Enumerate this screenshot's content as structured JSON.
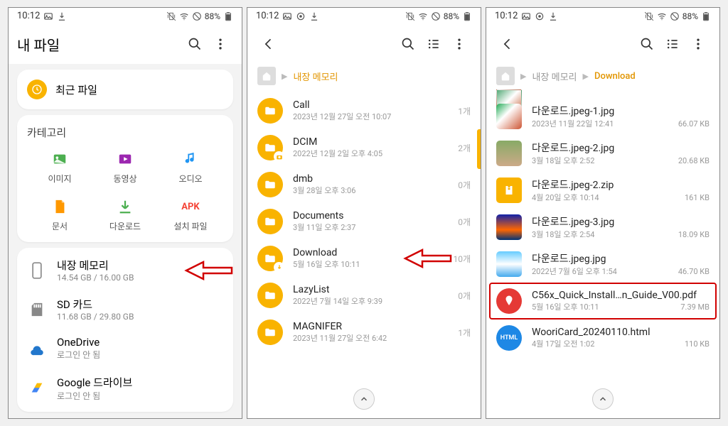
{
  "status": {
    "time": "10:12",
    "battery": "88%"
  },
  "s1": {
    "title": "내 파일",
    "recent": "최근 파일",
    "cat_title": "카테고리",
    "cats": [
      {
        "label": "이미지",
        "color": "#4CAF50"
      },
      {
        "label": "동영상",
        "color": "#9C27B0"
      },
      {
        "label": "오디오",
        "color": "#2196F3"
      },
      {
        "label": "문서",
        "color": "#FF9800"
      },
      {
        "label": "다운로드",
        "color": "#4CAF50"
      },
      {
        "label": "설치 파일",
        "color": "#FF5722",
        "text": "APK"
      }
    ],
    "storage": [
      {
        "name": "내장 메모리",
        "sub": "14.54 GB / 16.00 GB",
        "arrow": true
      },
      {
        "name": "SD 카드",
        "sub": "11.68 GB / 29.80 GB"
      },
      {
        "name": "OneDrive",
        "sub": "로그인 안 됨"
      },
      {
        "name": "Google 드라이브",
        "sub": "로그인 안 됨"
      }
    ]
  },
  "s2": {
    "crumb": "내장 메모리",
    "folders": [
      {
        "name": "Call",
        "sub": "2023년 12월 27일 오전 10:07",
        "count": "1개"
      },
      {
        "name": "DCIM",
        "sub": "2022년 12월 2일 오후 4:05",
        "count": "2개",
        "badge": "cam",
        "scroll": true
      },
      {
        "name": "dmb",
        "sub": "3월 28일 오후 3:06",
        "count": "0개"
      },
      {
        "name": "Documents",
        "sub": "3월 11일 오후 2:37",
        "count": "0개"
      },
      {
        "name": "Download",
        "sub": "5월 16일 오후 10:11",
        "count": "10개",
        "badge": "dl",
        "arrow": true
      },
      {
        "name": "LazyList",
        "sub": "2022년 7월 14일 오후 9:39",
        "count": "0개"
      },
      {
        "name": "MAGNIFER",
        "sub": "2023년 11월 27일 오전 6:42",
        "count": "1개"
      }
    ]
  },
  "s3": {
    "crumb1": "내장 메모리",
    "crumb2": "Download",
    "files": [
      {
        "name": "다운로드.jpeg-1.jpg",
        "sub": "2023년 11월 22일 12:41",
        "size": "66.07 KB",
        "thumb": "img1"
      },
      {
        "name": "다운로드.jpeg-2.jpg",
        "sub": "3월 18일 오후 2:52",
        "size": "20.68 KB",
        "thumb": "img2"
      },
      {
        "name": "다운로드.jpeg-2.zip",
        "sub": "4월 20일 오후 10:14",
        "size": "161 KB",
        "thumb": "zip"
      },
      {
        "name": "다운로드.jpeg-3.jpg",
        "sub": "3월 18일 오후 2:54",
        "size": "18.09 KB",
        "thumb": "img3"
      },
      {
        "name": "다운로드.jpeg.jpg",
        "sub": "2022년 7월 6일 오후 1:54",
        "size": "46.70 KB",
        "thumb": "img4"
      },
      {
        "name": "C56x_Quick_Install…n_Guide_V00.pdf",
        "sub": "5월 16일 오후 10:11",
        "size": "7.39 MB",
        "thumb": "pdf",
        "highlight": true
      },
      {
        "name": "WooriCard_20240110.html",
        "sub": "4월 17일 오전 1:02",
        "size": "110 KB",
        "thumb": "html"
      }
    ]
  }
}
